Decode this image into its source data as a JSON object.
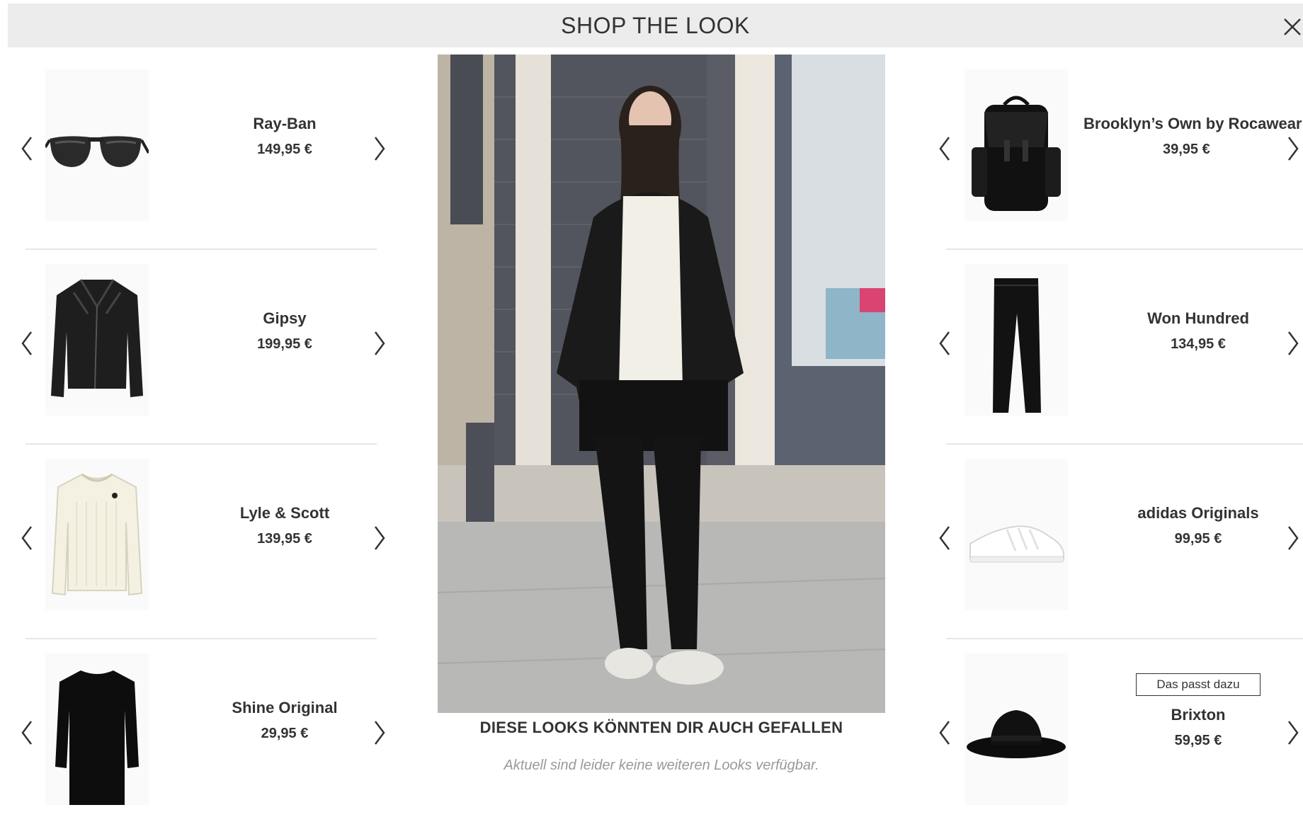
{
  "header": {
    "title": "SHOP THE LOOK",
    "close_icon": "close-icon"
  },
  "left_products": [
    {
      "brand": "Ray-Ban",
      "price": "149,95 €",
      "icon": "sunglasses-icon"
    },
    {
      "brand": "Gipsy",
      "price": "199,95 €",
      "icon": "leather-jacket-icon"
    },
    {
      "brand": "Lyle & Scott",
      "price": "139,95 €",
      "icon": "sweater-icon"
    },
    {
      "brand": "Shine Original",
      "price": "29,95 €",
      "icon": "long-shirt-icon"
    }
  ],
  "right_products": [
    {
      "brand": "Brooklyn’s Own by Rocawear",
      "price": "39,95 €",
      "icon": "backpack-icon"
    },
    {
      "brand": "Won Hundred",
      "price": "134,95 €",
      "icon": "jeans-icon"
    },
    {
      "brand": "adidas Originals",
      "price": "99,95 €",
      "icon": "sneaker-icon"
    },
    {
      "brand": "Brixton",
      "price": "59,95 €",
      "icon": "hat-icon",
      "tag": "Das passt dazu"
    }
  ],
  "more_looks": {
    "title": "DIESE LOOKS KÖNNTEN DIR AUCH GEFALLEN",
    "empty_message": "Aktuell sind leider keine weiteren Looks verfügbar."
  },
  "colors": {
    "header_bg": "#ececec",
    "text": "#333333",
    "muted": "#999999",
    "divider": "#e6e6e6"
  }
}
